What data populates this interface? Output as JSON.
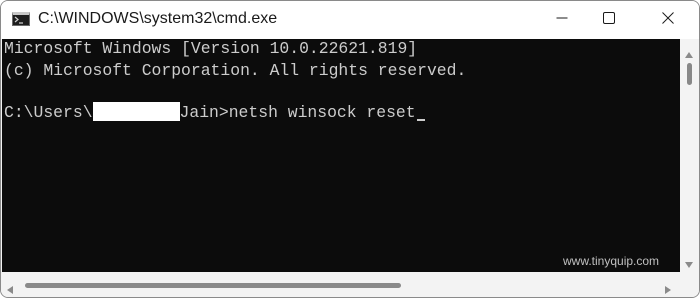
{
  "window": {
    "title": "C:\\WINDOWS\\system32\\cmd.exe",
    "icon": "cmd-icon",
    "controls": {
      "minimize": "minimize-icon",
      "maximize": "maximize-icon",
      "close": "close-icon"
    }
  },
  "console": {
    "lines": [
      "Microsoft Windows [Version 10.0.22621.819]",
      "(c) Microsoft Corporation. All rights reserved."
    ],
    "prompt_prefix": "C:\\Users\\",
    "prompt_suffix": "Jain>",
    "command": "netsh winsock reset",
    "background_color": "#0c0c0c",
    "text_color": "#cccccc"
  },
  "watermark": "www.tinyquip.com"
}
